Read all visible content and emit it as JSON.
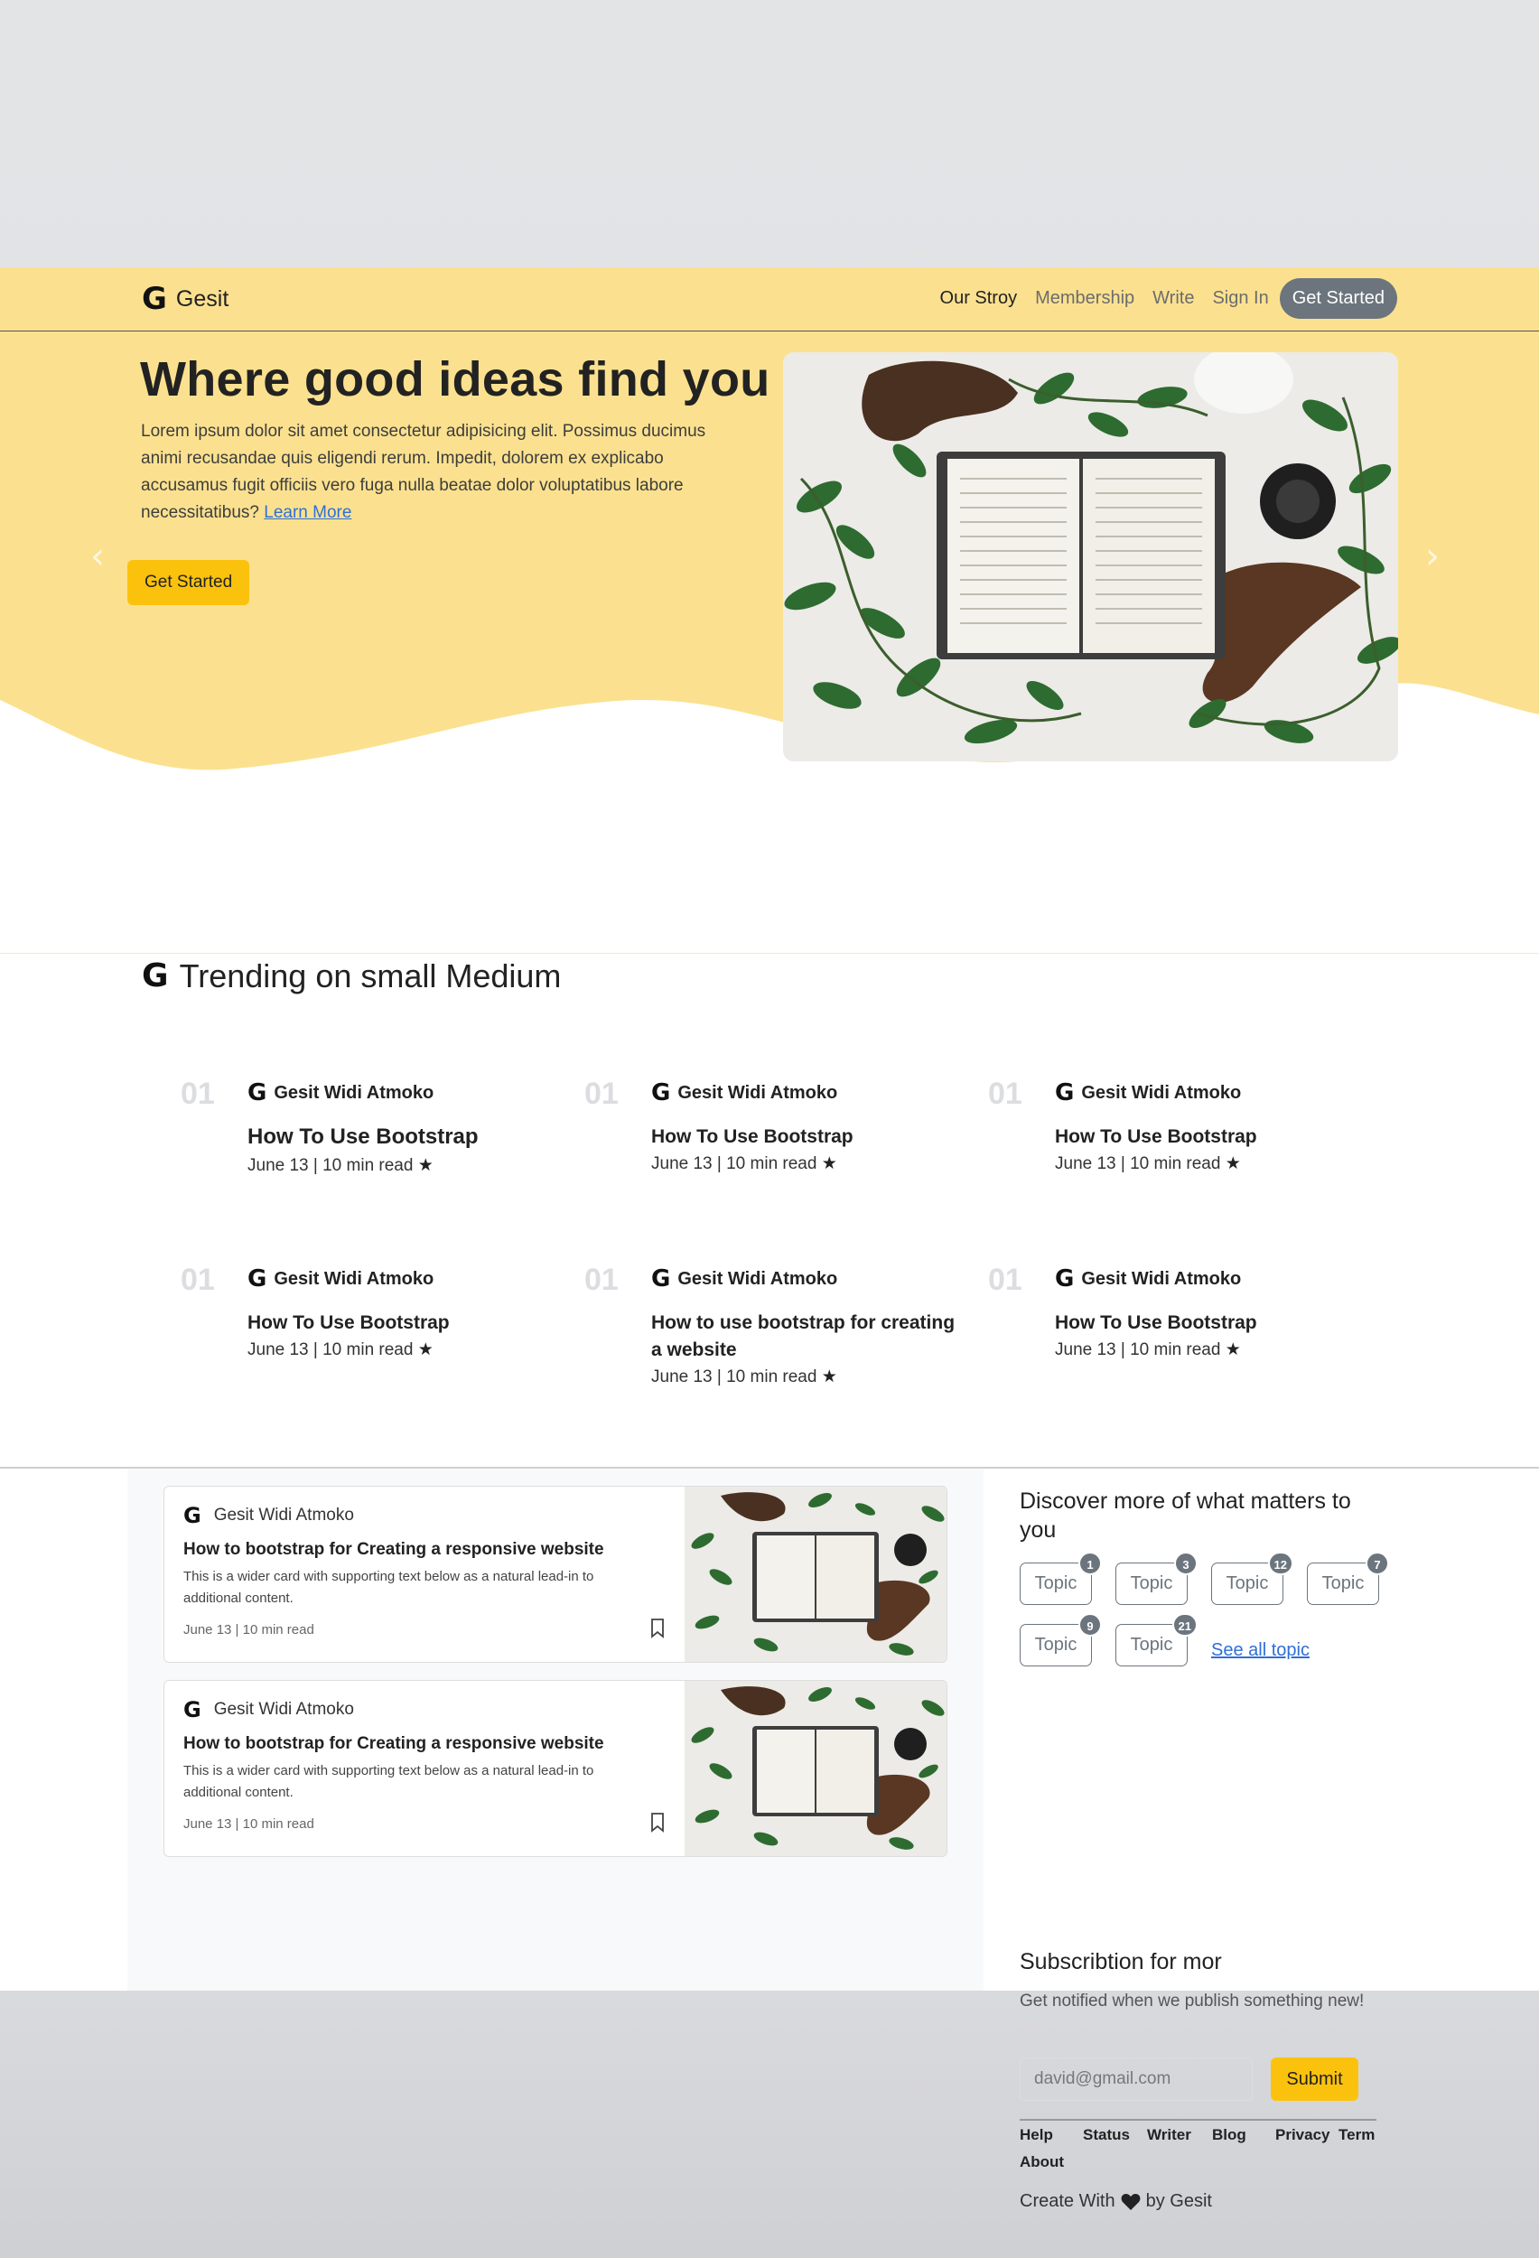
{
  "brand": {
    "logo": "G",
    "name": "Gesit"
  },
  "nav": {
    "links": [
      "Our Stroy",
      "Membership",
      "Write",
      "Sign In"
    ],
    "cta": "Get Started"
  },
  "hero": {
    "title": "Where good ideas find you",
    "text": "Lorem ipsum dolor sit amet consectetur adipisicing elit. Possimus ducimus animi recusandae quis eligendi rerum. Impedit, dolorem ex explicabo accusamus fugit officiis vero fuga nulla beatae dolor voluptatibus labore necessitatibus?",
    "learn_more": "Learn More",
    "button": "Get Started",
    "prev_icon": "‹",
    "next_icon": "›"
  },
  "trending": {
    "title": "Trending on small Medium",
    "items": [
      {
        "num": "01",
        "author": "Gesit Widi Atmoko",
        "headline": "How To Use Bootstrap",
        "meta": "June 13 | 10 min read"
      },
      {
        "num": "01",
        "author": "Gesit Widi Atmoko",
        "headline": "How To Use Bootstrap",
        "meta": "June 13 | 10 min read"
      },
      {
        "num": "01",
        "author": "Gesit Widi Atmoko",
        "headline": "How To Use Bootstrap",
        "meta": "June 13 | 10 min read"
      },
      {
        "num": "01",
        "author": "Gesit Widi Atmoko",
        "headline": "How To Use Bootstrap",
        "meta": "June 13 | 10 min read"
      },
      {
        "num": "01",
        "author": "Gesit Widi Atmoko",
        "headline": "How to use bootstrap for creating a website",
        "meta": "June 13 | 10 min read"
      },
      {
        "num": "01",
        "author": "Gesit Widi Atmoko",
        "headline": "How To Use Bootstrap",
        "meta": "June 13 | 10 min read"
      }
    ]
  },
  "cards": [
    {
      "author": "Gesit Widi Atmoko",
      "title": "How to bootstrap for Creating a responsive website",
      "text": "This is a wider card with supporting text below as a natural lead-in to additional content.",
      "meta": "June 13 | 10 min read"
    },
    {
      "author": "Gesit Widi Atmoko",
      "title": "How to bootstrap for Creating a responsive website",
      "text": "This is a wider card with supporting text below as a natural lead-in to additional content.",
      "meta": "June 13 | 10 min read"
    }
  ],
  "sidebar": {
    "discover_title": "Discover more of what matters to you",
    "topics": [
      {
        "label": "Topic",
        "count": "1"
      },
      {
        "label": "Topic",
        "count": "3"
      },
      {
        "label": "Topic",
        "count": "12"
      },
      {
        "label": "Topic",
        "count": "7"
      },
      {
        "label": "Topic",
        "count": "9"
      },
      {
        "label": "Topic",
        "count": "21"
      }
    ],
    "see_all": "See all topic",
    "subscribe_title": "Subscribtion for mor",
    "subscribe_text": "Get notified when we publish something new!",
    "email_placeholder": "david@gmail.com",
    "submit": "Submit",
    "footer_links": [
      "Help",
      "Status",
      "Writer",
      "Blog",
      "Privacy",
      "Term",
      "About"
    ],
    "credit_prefix": "Create With",
    "credit_suffix": "by Gesit"
  },
  "colors": {
    "accent": "#fbe18f",
    "button": "#fbc20d",
    "secondary": "#6c757d",
    "link": "#2f6fd6"
  }
}
